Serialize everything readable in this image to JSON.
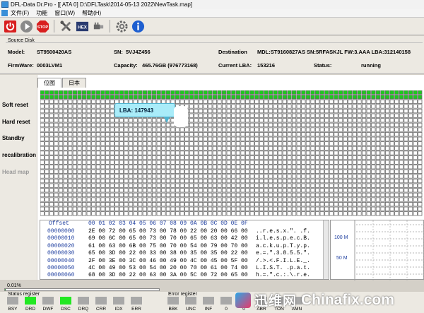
{
  "window": {
    "title": "DFL-Data Dr.Pro - [[ ATA 0]  D:\\DFLTask\\2014-05-13 2022\\NewTask.map]"
  },
  "menu": {
    "items": [
      "文件(F)",
      "功能",
      "窗口(W)",
      "帮助(H)"
    ]
  },
  "toolbar": {
    "buttons": [
      {
        "icon": "power-icon",
        "color": "#d81f1f"
      },
      {
        "icon": "play-icon",
        "color": "#7a7a7a"
      },
      {
        "icon": "stop-icon",
        "color": "#d81f1f",
        "label": "STOP"
      },
      {
        "icon": "tools-icon",
        "color": "#555555"
      },
      {
        "icon": "hex-icon",
        "color": "#2a3c70",
        "label": "HEX"
      },
      {
        "icon": "usb-plug-icon",
        "color": "#555555"
      },
      {
        "icon": "gear-icon",
        "color": "#666666"
      },
      {
        "icon": "info-icon",
        "color": "#1e5fd0"
      }
    ]
  },
  "source": {
    "header": "Source Disk",
    "model_label": "Model:",
    "model": "ST9500420AS",
    "sn_label": "SN:",
    "sn": "5VJ4Z456",
    "firmware_label": "FirmWare:",
    "firmware": "0003LVM1",
    "capacity_label": "Capacity:",
    "capacity": "465.76GB (976773168)"
  },
  "destination": {
    "label": "Destination",
    "info": "MDL:ST9160827AS  SN:5RFASKJL  FW:3.AAA  LBA:312140158",
    "current_lba_label": "Current LBA:",
    "current_lba": "153216",
    "status_label": "Status:",
    "status": "running"
  },
  "side_buttons": [
    {
      "label": "Soft reset",
      "enabled": true
    },
    {
      "label": "Hard reset",
      "enabled": true
    },
    {
      "label": "Standby",
      "enabled": true
    },
    {
      "label": "recalibration",
      "enabled": true
    },
    {
      "label": "Head map",
      "enabled": false
    }
  ],
  "tabs": [
    {
      "label": "位图",
      "active": true
    },
    {
      "label": "日本",
      "active": false
    }
  ],
  "bitmap": {
    "done_rows": 2,
    "done_color": "#1ec81e",
    "todo_color": "#ffffff",
    "cell_border": "#6a6a6a"
  },
  "tooltip": {
    "text": "LBA:   147943"
  },
  "hex": {
    "offset_header": "Offset",
    "column_header": "00 01 02 03 04 05 06 07 08 09 0A 0B 0C 0D 0E 0F",
    "rows": [
      {
        "addr": "00000000",
        "bytes": "2E 00 72 00 65 00 73 00 78 00 22 00 20 00 66 00",
        "ascii": "..r.e.s.x.\". .f."
      },
      {
        "addr": "00000010",
        "bytes": "69 00 6C 00 65 00 73 00 70 00 65 00 63 00 42 00",
        "ascii": "i.l.e.s.p.e.c.B."
      },
      {
        "addr": "00000020",
        "bytes": "61 00 63 00 6B 00 75 00 70 00 54 00 79 00 70 00",
        "ascii": "a.c.k.u.p.T.y.p."
      },
      {
        "addr": "00000030",
        "bytes": "65 00 3D 00 22 00 33 00 38 00 35 00 35 00 22 00",
        "ascii": "e.=.\".3.8.5.5.\"."
      },
      {
        "addr": "00000040",
        "bytes": "2F 00 3E 00 3C 00 46 00 49 00 4C 00 45 00 5F 00",
        "ascii": "/.>.<.F.I.L.E._."
      },
      {
        "addr": "00000050",
        "bytes": "4C 00 49 00 53 00 54 00 20 00 70 00 61 00 74 00",
        "ascii": "L.I.S.T. .p.a.t."
      },
      {
        "addr": "00000060",
        "bytes": "68 00 3D 00 22 00 63 00 3A 00 5C 00 72 00 65 00",
        "ascii": "h.=.\".c.:.\\.r.e."
      }
    ]
  },
  "speed_chart": {
    "labels": [
      "100 M",
      "50 M"
    ]
  },
  "progress": {
    "text": "0.01%",
    "fraction": 0.0001
  },
  "status_register": {
    "label": "Status register",
    "flags": [
      {
        "name": "BSY",
        "on": false
      },
      {
        "name": "DRD",
        "on": true
      },
      {
        "name": "DWF",
        "on": false
      },
      {
        "name": "DSC",
        "on": true
      },
      {
        "name": "DRQ",
        "on": false
      },
      {
        "name": "CRR",
        "on": false
      },
      {
        "name": "IDX",
        "on": false
      },
      {
        "name": "ERR",
        "on": false
      }
    ]
  },
  "error_register": {
    "label": "Error register",
    "flags": [
      {
        "name": "BBK",
        "on": false
      },
      {
        "name": "UNC",
        "on": false
      },
      {
        "name": "INF",
        "on": false
      },
      {
        "name": "0",
        "on": false
      },
      {
        "name": "0",
        "on": false
      },
      {
        "name": "ABR",
        "on": false
      },
      {
        "name": "TON",
        "on": false
      },
      {
        "name": "AMN",
        "on": false
      }
    ]
  },
  "watermark": {
    "cn": "迅维网",
    "en": "Chinafix.com"
  }
}
